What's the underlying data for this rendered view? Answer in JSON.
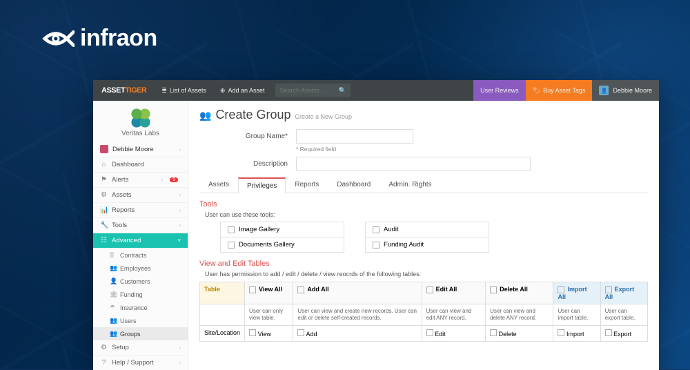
{
  "brand_logo": "infraon",
  "topbar": {
    "brand_a": "ASSET",
    "brand_t": "TIGER",
    "list_assets": "List of Assets",
    "add_asset": "Add an Asset",
    "search_placeholder": "Search Assets ...",
    "user_reviews": "User Reviews",
    "buy_tags": "Buy Asset Tags",
    "user_name": "Debbie Moore"
  },
  "company": {
    "name": "Veritas Labs"
  },
  "sidebar": {
    "user": "Debbie Moore",
    "items": [
      {
        "label": "Dashboard"
      },
      {
        "label": "Alerts",
        "badge": "9"
      },
      {
        "label": "Assets"
      },
      {
        "label": "Reports"
      },
      {
        "label": "Tools"
      },
      {
        "label": "Advanced",
        "active": true
      },
      {
        "label": "Setup"
      },
      {
        "label": "Help / Support"
      }
    ],
    "advanced_sub": [
      {
        "label": "Contracts"
      },
      {
        "label": "Employees"
      },
      {
        "label": "Customers"
      },
      {
        "label": "Funding"
      },
      {
        "label": "Insurance"
      },
      {
        "label": "Users"
      },
      {
        "label": "Groups",
        "sel": true
      }
    ]
  },
  "page": {
    "title": "Create Group",
    "subtitle": "Create a New Group",
    "group_name_label": "Group Name*",
    "required_note": "* Required field",
    "description_label": "Description"
  },
  "tabs": [
    "Assets",
    "Privileges",
    "Reports",
    "Dashboard",
    "Admin. Rights"
  ],
  "tools_section": {
    "heading": "Tools",
    "note": "User can use these tools:",
    "col1": [
      "Image Gallery",
      "Documents Gallery"
    ],
    "col2": [
      "Audit",
      "Funding Audit"
    ]
  },
  "tables_section": {
    "heading": "View and Edit Tables",
    "note": "User has permission to add / edit / delete / view reocrds of the following tables:",
    "headers": [
      "Table",
      "View All",
      "Add All",
      "Edit All",
      "Delete All",
      "Import All",
      "Export All"
    ],
    "descs": [
      "",
      "User can only view table.",
      "User can view and create new records. User can edit or delete self-created records.",
      "User can view and edit ANY record.",
      "User can view and delete ANY record.",
      "User can import table.",
      "User can export table."
    ],
    "rows": [
      {
        "name": "Site/Location",
        "actions": [
          "View",
          "Add",
          "Edit",
          "Delete",
          "Import",
          "Export"
        ]
      }
    ]
  }
}
